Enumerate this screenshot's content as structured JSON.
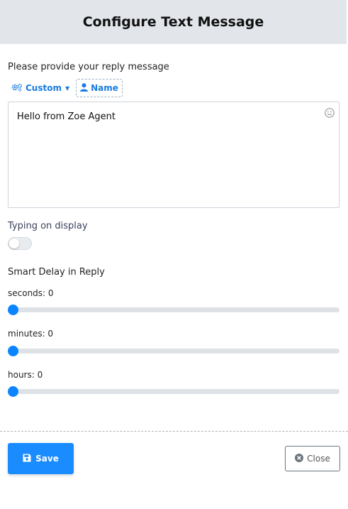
{
  "header": {
    "title": "Configure Text Message"
  },
  "reply": {
    "prompt": "Please provide your reply message",
    "custom_label": "Custom",
    "name_label": "Name",
    "message": "Hello from Zoe Agent"
  },
  "typing": {
    "label": "Typing on display",
    "enabled": false
  },
  "delay": {
    "label": "Smart Delay in Reply",
    "seconds_label": "seconds: 0",
    "minutes_label": "minutes: 0",
    "hours_label": "hours: 0",
    "seconds": 0,
    "minutes": 0,
    "hours": 0
  },
  "footer": {
    "save_label": "Save",
    "close_label": "Close"
  },
  "colors": {
    "accent": "#1a8cff",
    "header_bg": "#e2e5ea"
  },
  "icons": {
    "custom": "gears-icon",
    "name": "user-icon",
    "emoji": "smile-icon",
    "save": "floppy-disk-icon",
    "close": "times-circle-icon"
  }
}
